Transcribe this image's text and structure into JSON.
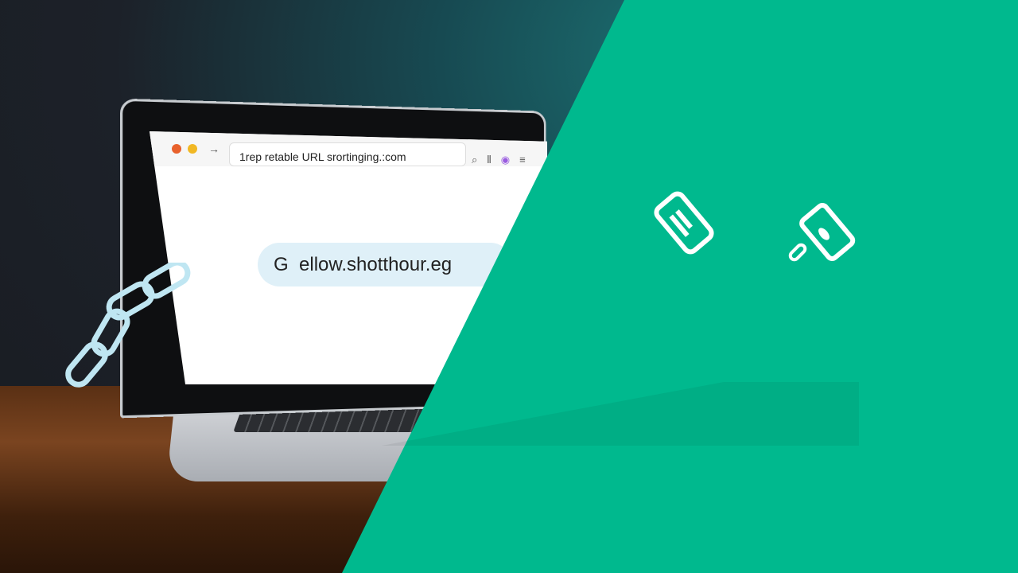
{
  "browser": {
    "address_bar": "1rep retable URL srortinging.:com",
    "short_link": "ellow.shotthour.eg",
    "short_link_prefix": "G"
  },
  "icons": [
    "close-dot",
    "minimize-dot",
    "forward-arrow",
    "search-icon",
    "extension-icon",
    "profile-icon",
    "menu-icon",
    "chain-link-icon",
    "phone-link-icon",
    "phone-card-link-icon"
  ],
  "colors": {
    "accent": "#00b98e",
    "close": "#e8612c",
    "minimize": "#f1b824"
  }
}
